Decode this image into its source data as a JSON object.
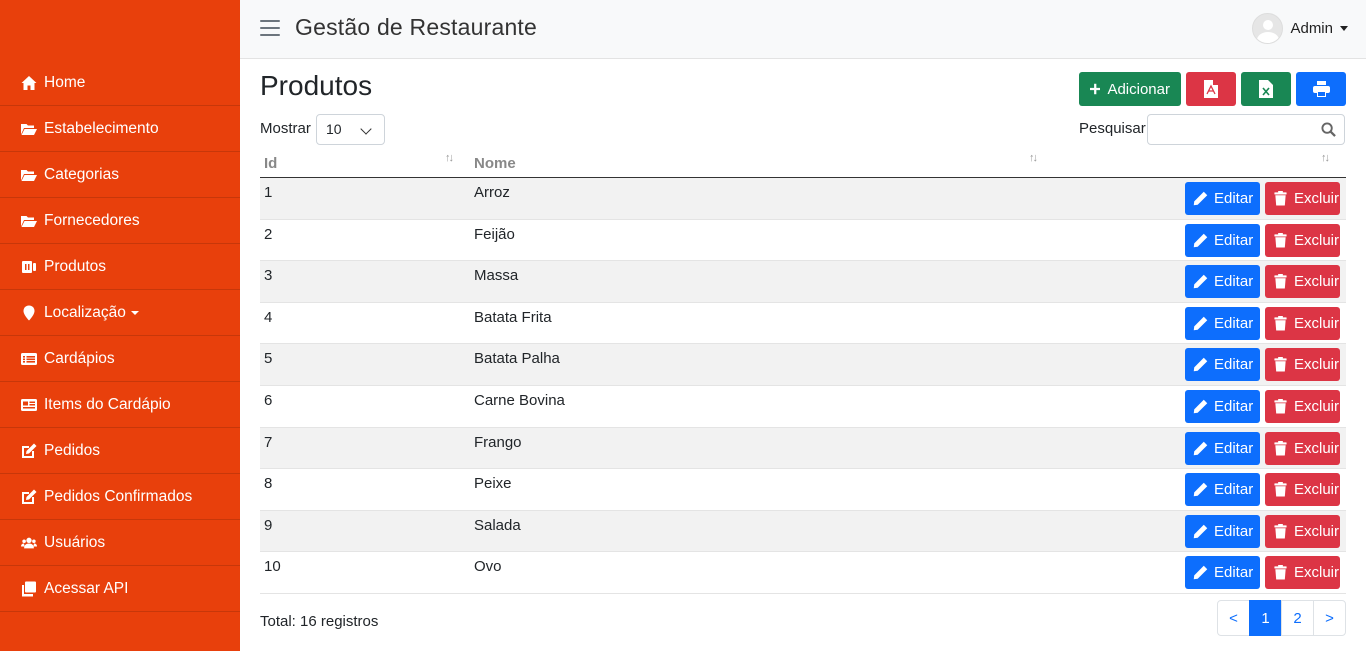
{
  "app": {
    "title": "Gestão de Restaurante"
  },
  "user": {
    "name": "Admin"
  },
  "sidebar": {
    "items": [
      {
        "label": "Home",
        "icon": "home-icon"
      },
      {
        "label": "Estabelecimento",
        "icon": "folder-open-icon"
      },
      {
        "label": "Categorias",
        "icon": "folder-open-icon"
      },
      {
        "label": "Fornecedores",
        "icon": "folder-open-icon"
      },
      {
        "label": "Produtos",
        "icon": "product-icon"
      },
      {
        "label": "Localização",
        "icon": "map-marker-icon",
        "has_dropdown": true
      },
      {
        "label": "Cardápios",
        "icon": "list-icon"
      },
      {
        "label": "Items do Cardápio",
        "icon": "newspaper-icon"
      },
      {
        "label": "Pedidos",
        "icon": "edit-icon"
      },
      {
        "label": "Pedidos Confirmados",
        "icon": "edit-icon"
      },
      {
        "label": "Usuários",
        "icon": "users-icon"
      },
      {
        "label": "Acessar API",
        "icon": "copy-icon"
      }
    ]
  },
  "page": {
    "title": "Produtos",
    "add_label": "Adicionar",
    "show_label": "Mostrar",
    "show_value": "10",
    "search_label": "Pesquisar",
    "search_value": ""
  },
  "table": {
    "columns": [
      "Id",
      "Nome"
    ],
    "edit_label": "Editar",
    "delete_label": "Excluir",
    "rows": [
      {
        "id": "1",
        "name": "Arroz"
      },
      {
        "id": "2",
        "name": "Feijão"
      },
      {
        "id": "3",
        "name": "Massa"
      },
      {
        "id": "4",
        "name": "Batata Frita"
      },
      {
        "id": "5",
        "name": "Batata Palha"
      },
      {
        "id": "6",
        "name": "Carne Bovina"
      },
      {
        "id": "7",
        "name": "Frango"
      },
      {
        "id": "8",
        "name": "Peixe"
      },
      {
        "id": "9",
        "name": "Salada"
      },
      {
        "id": "10",
        "name": "Ovo"
      }
    ]
  },
  "footer": {
    "total": "Total: 16 registros",
    "pagination": {
      "prev": "<",
      "pages": [
        "1",
        "2"
      ],
      "current": "1",
      "next": ">"
    }
  },
  "colors": {
    "sidebar": "#e8400c",
    "primary": "#0d6efd",
    "danger": "#dc3545",
    "success": "#198754"
  }
}
